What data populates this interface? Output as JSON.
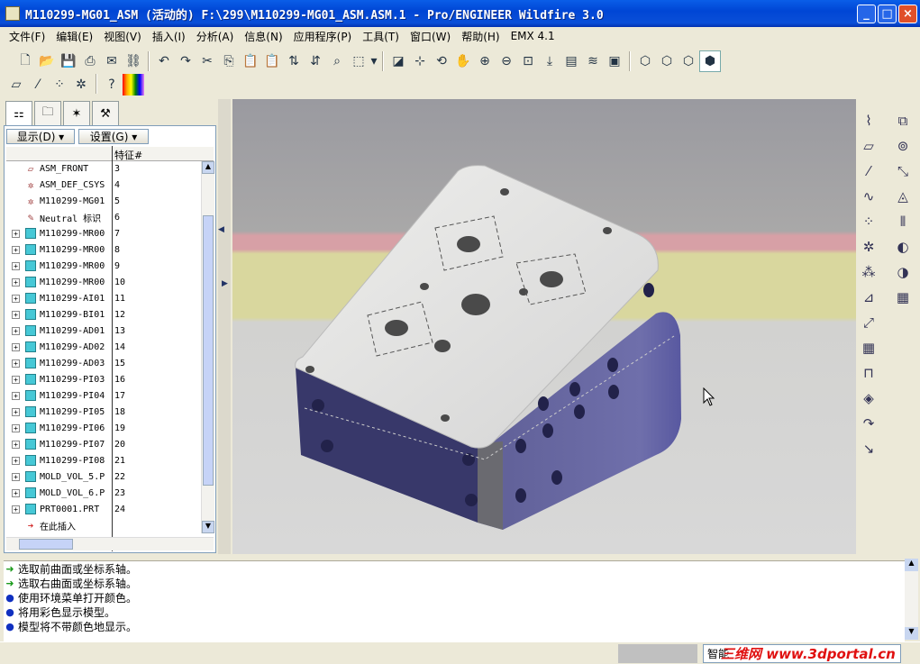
{
  "window": {
    "title": "M110299-MG01_ASM (活动的) F:\\299\\M110299-MG01_ASM.ASM.1 - Pro/ENGINEER Wildfire 3.0"
  },
  "menu": [
    "文件(F)",
    "编辑(E)",
    "视图(V)",
    "插入(I)",
    "分析(A)",
    "信息(N)",
    "应用程序(P)",
    "工具(T)",
    "窗口(W)",
    "帮助(H)",
    "EMX 4.1"
  ],
  "nav": {
    "show_label": "显示(D) ▾",
    "settings_label": "设置(G) ▾",
    "col_feature": "特征#"
  },
  "tree": [
    {
      "name": "ASM_FRONT",
      "num": "3",
      "icon": "datum-plane-icon",
      "expand": false
    },
    {
      "name": "ASM_DEF_CSYS",
      "num": "4",
      "icon": "csys-icon",
      "expand": false
    },
    {
      "name": "M110299-MG01",
      "num": "5",
      "icon": "csys-icon",
      "expand": false
    },
    {
      "name": "Neutral 标识",
      "num": "6",
      "icon": "note-icon",
      "expand": false
    },
    {
      "name": "M110299-MR00",
      "num": "7",
      "icon": "part-icon",
      "expand": true
    },
    {
      "name": "M110299-MR00:",
      "num": "8",
      "icon": "part-icon",
      "expand": true
    },
    {
      "name": "M110299-MR00:",
      "num": "9",
      "icon": "part-icon",
      "expand": true
    },
    {
      "name": "M110299-MR00-",
      "num": "10",
      "icon": "part-icon",
      "expand": true
    },
    {
      "name": "M110299-AI01",
      "num": "11",
      "icon": "part-icon",
      "expand": true
    },
    {
      "name": "M110299-BI01",
      "num": "12",
      "icon": "part-icon",
      "expand": true
    },
    {
      "name": "M110299-AD01",
      "num": "13",
      "icon": "part-icon",
      "expand": true
    },
    {
      "name": "M110299-AD02",
      "num": "14",
      "icon": "part-icon",
      "expand": true
    },
    {
      "name": "M110299-AD03",
      "num": "15",
      "icon": "part-icon",
      "expand": true
    },
    {
      "name": "M110299-PI03",
      "num": "16",
      "icon": "part-icon",
      "expand": true
    },
    {
      "name": "M110299-PI04",
      "num": "17",
      "icon": "part-icon",
      "expand": true
    },
    {
      "name": "M110299-PI05",
      "num": "18",
      "icon": "part-icon",
      "expand": true
    },
    {
      "name": "M110299-PI06",
      "num": "19",
      "icon": "part-icon",
      "expand": true
    },
    {
      "name": "M110299-PI07",
      "num": "20",
      "icon": "part-icon",
      "expand": true
    },
    {
      "name": "M110299-PI08",
      "num": "21",
      "icon": "part-icon",
      "expand": true
    },
    {
      "name": "MOLD_VOL_5.P",
      "num": "22",
      "icon": "part-icon",
      "expand": true
    },
    {
      "name": "MOLD_VOL_6.P",
      "num": "23",
      "icon": "part-icon",
      "expand": true
    },
    {
      "name": "PRT0001.PRT",
      "num": "24",
      "icon": "part-icon",
      "expand": true
    },
    {
      "name": "在此插入",
      "num": "",
      "icon": "insert-here-arrow-icon",
      "expand": false
    }
  ],
  "messages": [
    {
      "icon": "green-arrow-icon",
      "text": "选取前曲面或坐标系轴。"
    },
    {
      "icon": "green-arrow-icon",
      "text": "选取右曲面或坐标系轴。"
    },
    {
      "icon": "bullet-icon",
      "text": "使用环境菜单打开颜色。"
    },
    {
      "icon": "bullet-icon",
      "text": "将用彩色显示模型。"
    },
    {
      "icon": "bullet-icon",
      "text": "模型将不带颜色地显示。"
    }
  ],
  "status": {
    "select_value": "智能"
  },
  "watermark": "三维网 www.3dportal.cn"
}
